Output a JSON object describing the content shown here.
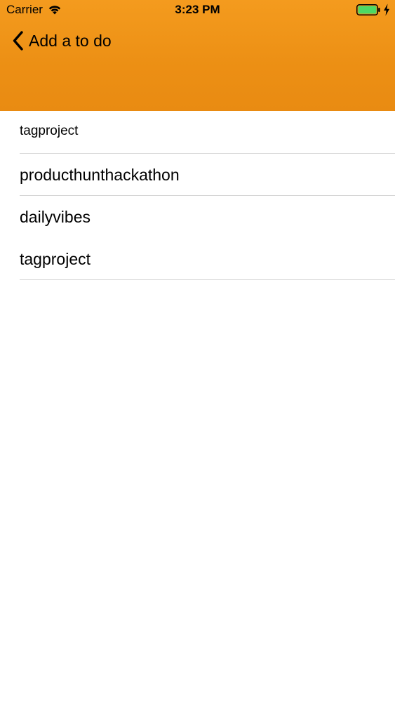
{
  "status_bar": {
    "carrier": "Carrier",
    "time": "3:23 PM",
    "icons": [
      "wifi-icon",
      "battery-icon",
      "charging-bolt-icon"
    ]
  },
  "nav": {
    "back_label": "Add a to do",
    "back_icon": "chevron-left-icon"
  },
  "search": {
    "value": "tagproject"
  },
  "suggestions": [
    {
      "label": "producthunthackathon"
    },
    {
      "label": "dailyvibes"
    },
    {
      "label": "tagproject"
    }
  ],
  "colors": {
    "header_top": "#f49b1e",
    "header_bottom": "#e98b12",
    "battery_fill": "#4cd964",
    "separator": "#d6d6d6"
  }
}
